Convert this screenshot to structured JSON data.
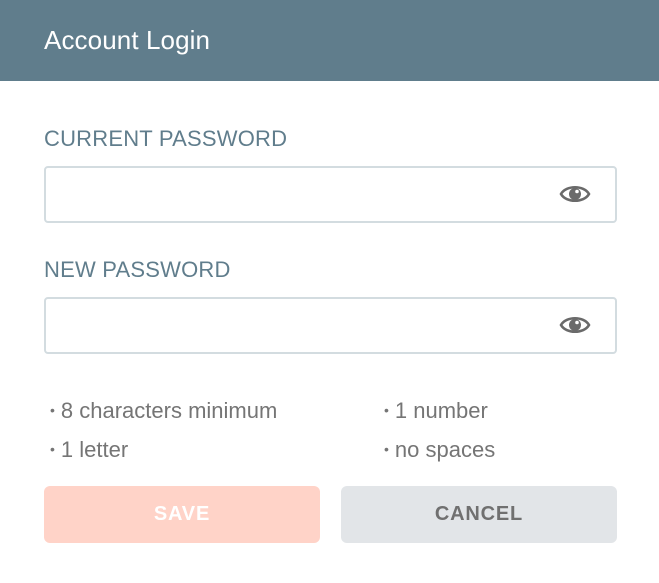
{
  "header": {
    "title": "Account Login"
  },
  "current_password": {
    "label": "CURRENT PASSWORD",
    "value": "",
    "placeholder": "",
    "toggle_icon": "eye-icon"
  },
  "new_password": {
    "label": "NEW PASSWORD",
    "value": "",
    "placeholder": "",
    "toggle_icon": "eye-icon"
  },
  "requirements": [
    {
      "text": "8 characters minimum"
    },
    {
      "text": "1 number"
    },
    {
      "text": "1 letter"
    },
    {
      "text": "no spaces"
    }
  ],
  "actions": {
    "save_label": "SAVE",
    "cancel_label": "CANCEL",
    "save_enabled": false
  },
  "colors": {
    "header_bg": "#607d8c",
    "label": "#607d8c",
    "save_bg": "#ffd3c8",
    "cancel_bg": "#e2e5e8",
    "input_border": "#d3dce0"
  }
}
